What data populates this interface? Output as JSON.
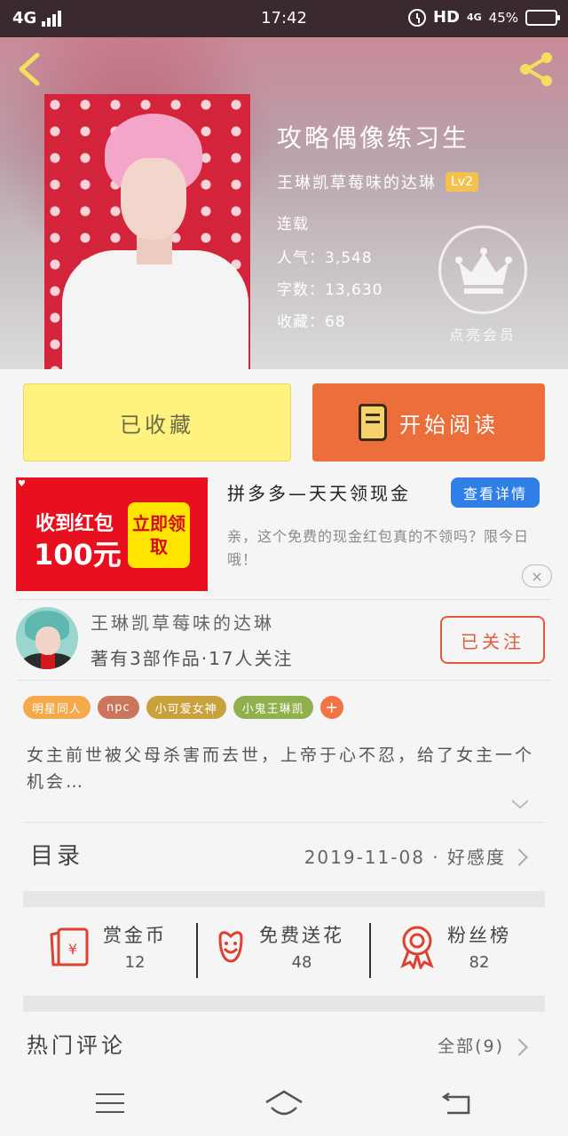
{
  "status_bar": {
    "network": "4G",
    "time": "17:42",
    "hd": "HD",
    "net_small": "4G",
    "battery_pct": "45%",
    "battery_level": 0.45
  },
  "book": {
    "title": "攻略偶像练习生",
    "author": "王琳凯草莓味的达琳",
    "author_level": "Lv2",
    "status": "连载",
    "popularity": "人气：3,548",
    "word_count": "字数：13,630",
    "collections": "收藏：68",
    "vip_label": "点亮会员"
  },
  "actions": {
    "collected_label": "已收藏",
    "read_label": "开始阅读"
  },
  "ad": {
    "image_line1": "收到红包",
    "image_line2": "100元",
    "image_badge": "立即领取",
    "title": "拼多多—天天领现金",
    "detail_button": "查看详情",
    "description": "亲，这个免费的现金红包真的不领吗？限今日哦！",
    "close": "×"
  },
  "author_card": {
    "name": "王琳凯草莓味的达琳",
    "stats": "著有3部作品·17人关注",
    "follow_label": "已关注"
  },
  "tags": [
    {
      "label": "明星同人",
      "color": "#f5a94a"
    },
    {
      "label": "npc",
      "color": "#c9765d"
    },
    {
      "label": "小可爱女神",
      "color": "#c9a23d"
    },
    {
      "label": "小鬼王琳凯",
      "color": "#8fb04c"
    }
  ],
  "tag_add": "+",
  "summary": "女主前世被父母杀害而去世，上帝于心不忍，给了女主一个机会…",
  "catalog": {
    "label": "目录",
    "info": "2019-11-08 · 好感度"
  },
  "stats": [
    {
      "label": "赏金币",
      "value": "12",
      "icon": "red-envelope-icon"
    },
    {
      "label": "免费送花",
      "value": "48",
      "icon": "flower-icon"
    },
    {
      "label": "粉丝榜",
      "value": "82",
      "icon": "medal-icon"
    }
  ],
  "comments": {
    "label": "热门评论",
    "all": "全部(9)"
  },
  "colors": {
    "accent_orange": "#ec6e3b",
    "collected_yellow": "#fff27e",
    "icon_red": "#e0402e"
  }
}
